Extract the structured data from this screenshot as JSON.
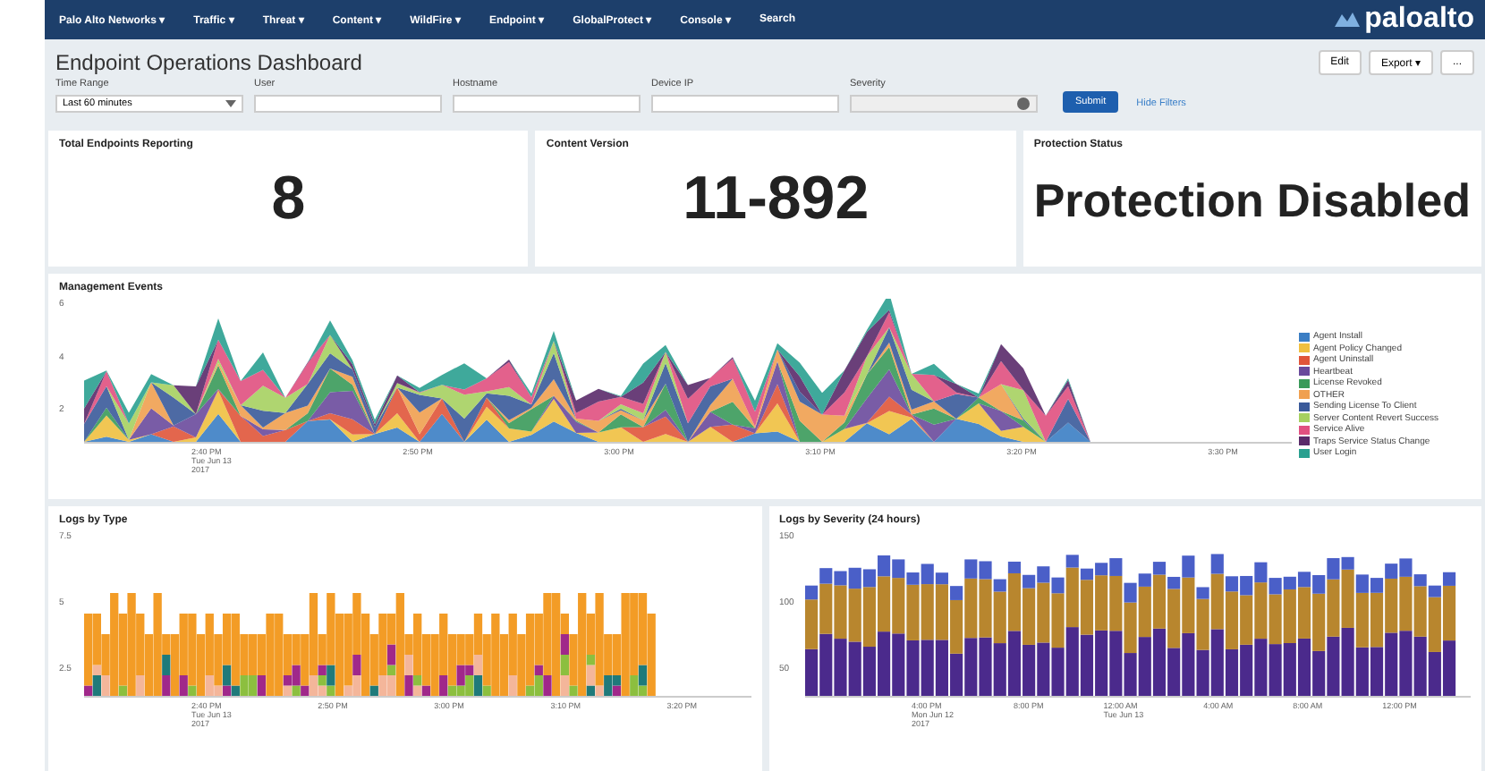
{
  "nav": {
    "items": [
      "Palo Alto Networks ▾",
      "Traffic ▾",
      "Threat ▾",
      "Content ▾",
      "WildFire ▾",
      "Endpoint ▾",
      "GlobalProtect ▾",
      "Console ▾",
      "Search"
    ],
    "logo": "paloalto"
  },
  "page": {
    "title": "Endpoint Operations Dashboard",
    "buttons": [
      "Edit",
      "Export ▾",
      "..."
    ]
  },
  "filters": [
    {
      "label": "Time Range",
      "kind": "select",
      "value": "Last 60 minutes"
    },
    {
      "label": "User",
      "kind": "text"
    },
    {
      "label": "Hostname",
      "kind": "text"
    },
    {
      "label": "Device IP",
      "kind": "text"
    },
    {
      "label": "Severity",
      "kind": "multiselect"
    }
  ],
  "submit": "Submit",
  "hide_filters": "Hide Filters",
  "cards": [
    {
      "title": "Total Endpoints Reporting",
      "value": "8"
    },
    {
      "title": "Content Version",
      "value": "11-892"
    },
    {
      "title": "Protection Status",
      "value": "Protection Disabled"
    }
  ],
  "management": {
    "title": "Management Events",
    "yticks": [
      "6",
      "4",
      "2"
    ],
    "xticks": [
      {
        "time": "2:40 PM",
        "date": "Tue Jun 13",
        "year": "2017"
      },
      {
        "time": "2:50 PM"
      },
      {
        "time": "3:00 PM"
      },
      {
        "time": "3:10 PM"
      },
      {
        "time": "3:20 PM"
      },
      {
        "time": "3:30 PM"
      }
    ],
    "legend": [
      {
        "name": "Agent Install",
        "color": "#3b7ec4"
      },
      {
        "name": "Agent Policy Changed",
        "color": "#f0c040"
      },
      {
        "name": "Agent Uninstall",
        "color": "#e0553a"
      },
      {
        "name": "Heartbeat",
        "color": "#6a4a9c"
      },
      {
        "name": "License Revoked",
        "color": "#3a9a5a"
      },
      {
        "name": "OTHER",
        "color": "#f0a050"
      },
      {
        "name": "Sending License To Client",
        "color": "#3a5a9a"
      },
      {
        "name": "Server Content Revert Success",
        "color": "#a6d060"
      },
      {
        "name": "Service Alive",
        "color": "#e05080"
      },
      {
        "name": "Traps Service Status Change",
        "color": "#5a2a6a"
      },
      {
        "name": "User Login",
        "color": "#2aa090"
      }
    ]
  },
  "logs_by_type": {
    "title": "Logs by Type",
    "yticks": [
      "7.5",
      "5",
      "2.5"
    ],
    "xticks": [
      {
        "time": "2:40 PM",
        "date": "Tue Jun 13",
        "year": "2017"
      },
      {
        "time": "2:50 PM"
      },
      {
        "time": "3:00 PM"
      },
      {
        "time": "3:10 PM"
      },
      {
        "time": "3:20 PM"
      }
    ]
  },
  "logs_by_severity": {
    "title": "Logs by Severity (24 hours)",
    "yticks": [
      "150",
      "100",
      "50"
    ],
    "xticks": [
      {
        "time": "4:00 PM",
        "date": "Mon Jun 12",
        "year": "2017"
      },
      {
        "time": "8:00 PM"
      },
      {
        "time": "12:00 AM",
        "date": "Tue Jun 13"
      },
      {
        "time": "4:00 AM"
      },
      {
        "time": "8:00 AM"
      },
      {
        "time": "12:00 PM"
      }
    ]
  }
}
